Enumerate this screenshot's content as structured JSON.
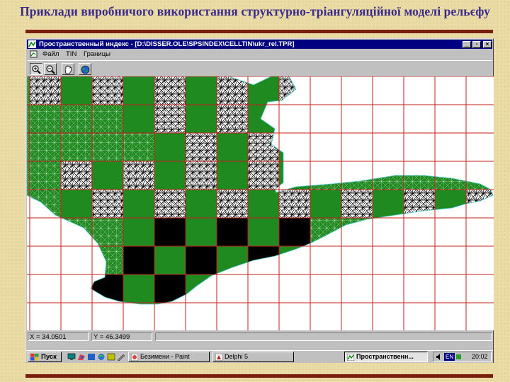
{
  "slide": {
    "title": "Приклади виробничого використання структурно-тріангуляційної моделі рельєфу"
  },
  "window": {
    "title": "Пространственный индекс - [D:\\DISSER.OLE\\SPSINDEX\\CELLTIN\\ukr_rel.TPR]",
    "buttons": {
      "minimize": "_",
      "restore": "▫",
      "close": "×"
    }
  },
  "menu": {
    "items": [
      "Файл",
      "TIN",
      "Границы"
    ]
  },
  "toolbar": {
    "tools": [
      "zoom-in-icon",
      "zoom-out-icon",
      "hand-pan-icon",
      "globe-icon"
    ]
  },
  "status": {
    "x": "X = 34.0501",
    "y": "Y = 46.3499"
  },
  "taskbar": {
    "start_label": "Пуск",
    "tasks": [
      "Безимени - Paint",
      "Delphi 5",
      "Пространственн..."
    ],
    "lang": "EN",
    "clock": "20:02"
  },
  "colors": {
    "land_green": "#1f8a1f",
    "tin_black": "#000000",
    "grid_red": "#c81e1e",
    "titlebar": "#000080",
    "slide_title": "#3b2a8c",
    "rule": "#7a1f10"
  },
  "map": {
    "grid": {
      "columns": 15,
      "rows": 8
    },
    "filled_cells": {
      "row0": "BGBGBGBGBG",
      "row1": "...GBGBG.",
      "row2": "....GBGBG.",
      "row3": ".BGBGBGBG",
      "row4": ".GBGBGBGBGBGBGBG",
      "row5": "...GBGBGB",
      "row6": "...BGBGBG",
      "row7": "..BGBGB"
    }
  }
}
